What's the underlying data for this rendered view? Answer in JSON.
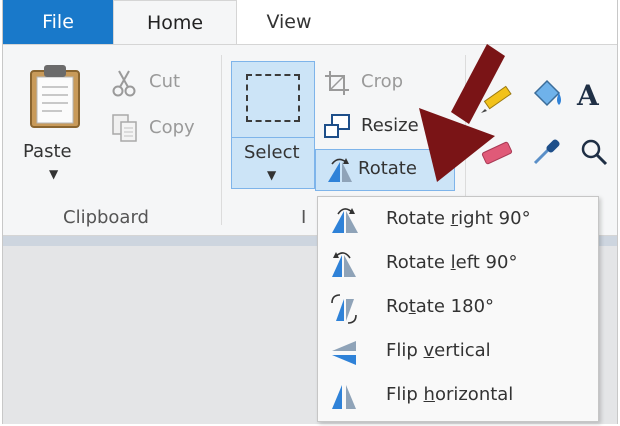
{
  "tabs": {
    "file": "File",
    "home": "Home",
    "view": "View"
  },
  "clipboard": {
    "paste": "Paste",
    "cut": "Cut",
    "copy": "Copy",
    "group_label": "Clipboard"
  },
  "image": {
    "select": "Select",
    "crop": "Crop",
    "resize": "Resize",
    "rotate": "Rotate",
    "group_label_partial": "I"
  },
  "rotate_menu": {
    "items": [
      {
        "pre": "Rotate ",
        "key": "r",
        "post": "ight 90°",
        "icon": "rotate-right-icon"
      },
      {
        "pre": "Rotate ",
        "key": "l",
        "post": "eft 90°",
        "icon": "rotate-left-icon"
      },
      {
        "pre": "Ro",
        "key": "t",
        "post": "ate 180°",
        "icon": "rotate-180-icon"
      },
      {
        "pre": "Flip ",
        "key": "v",
        "post": "ertical",
        "icon": "flip-vertical-icon"
      },
      {
        "pre": "Flip ",
        "key": "h",
        "post": "orizontal",
        "icon": "flip-horizontal-icon"
      }
    ]
  },
  "tools": {
    "text_glyph": "A"
  },
  "colors": {
    "file_tab": "#1979ca",
    "selection_fill": "#cce4f7",
    "selection_border": "#7eb4ea",
    "annotation_arrow": "#7a1416"
  }
}
